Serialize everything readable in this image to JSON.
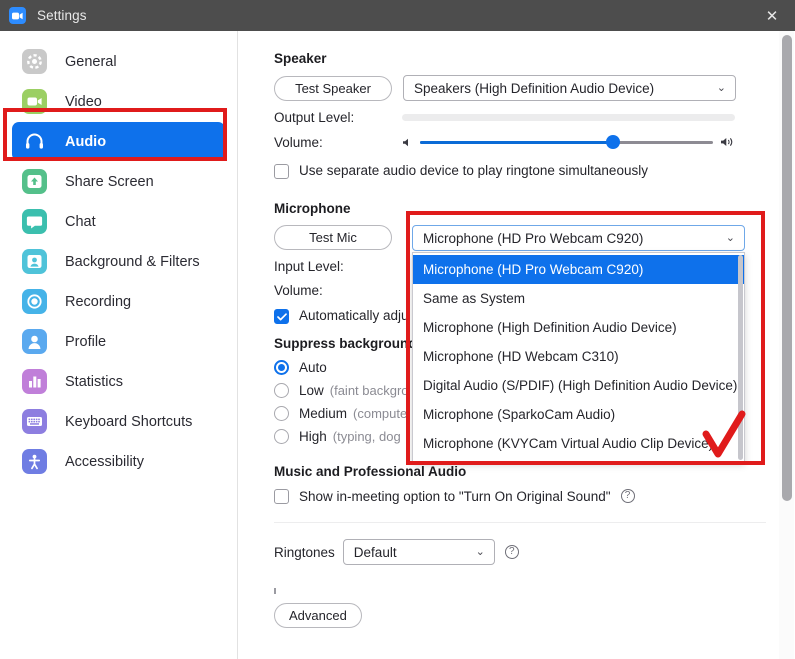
{
  "window": {
    "title": "Settings",
    "logo_icon": "zoom-video-icon",
    "close_icon": "close-icon",
    "titlebar_color": "#4d4d4d"
  },
  "accent_color": "#0e71eb",
  "annotation_color": "#e01b1b",
  "sidebar": {
    "items": [
      {
        "label": "General",
        "icon": "gear-icon",
        "icon_color": "#c6c6c6",
        "active": false
      },
      {
        "label": "Video",
        "icon": "video-camera-icon",
        "icon_color": "#9bcf63",
        "active": false
      },
      {
        "label": "Audio",
        "icon": "headphones-icon",
        "icon_color": "#0e71eb",
        "active": true
      },
      {
        "label": "Share Screen",
        "icon": "share-screen-icon",
        "icon_color": "#54c08a",
        "active": false
      },
      {
        "label": "Chat",
        "icon": "chat-bubble-icon",
        "icon_color": "#3bbfae",
        "active": false
      },
      {
        "label": "Background & Filters",
        "icon": "person-frame-icon",
        "icon_color": "#4fc3d9",
        "active": false
      },
      {
        "label": "Recording",
        "icon": "record-circle-icon",
        "icon_color": "#45b3e8",
        "active": false
      },
      {
        "label": "Profile",
        "icon": "person-icon",
        "icon_color": "#5aa9ef",
        "active": false
      },
      {
        "label": "Statistics",
        "icon": "bar-chart-icon",
        "icon_color": "#c07fd9",
        "active": false
      },
      {
        "label": "Keyboard Shortcuts",
        "icon": "keyboard-icon",
        "icon_color": "#8d7ee0",
        "active": false
      },
      {
        "label": "Accessibility",
        "icon": "accessibility-icon",
        "icon_color": "#6f7de3",
        "active": false
      }
    ]
  },
  "speaker": {
    "heading": "Speaker",
    "test_button": "Test Speaker",
    "device": "Speakers (High Definition Audio Device)",
    "output_level_label": "Output Level:",
    "output_level_percent": 0,
    "volume_label": "Volume:",
    "volume_percent": 66,
    "min_icon": "speaker-low-icon",
    "max_icon": "speaker-high-icon",
    "ringtone_checkbox": {
      "label": "Use separate audio device to play ringtone simultaneously",
      "checked": false
    }
  },
  "microphone": {
    "heading": "Microphone",
    "test_button": "Test Mic",
    "selected_device": "Microphone (HD Pro Webcam C920)",
    "input_level_label": "Input Level:",
    "volume_label": "Volume:",
    "auto_adjust": {
      "label": "Automatically adju",
      "checked": true
    },
    "dropdown_open": true,
    "dropdown_options": [
      "Microphone (HD Pro Webcam C920)",
      "Same as System",
      "Microphone (High Definition Audio Device)",
      "Microphone (HD Webcam C310)",
      "Digital Audio (S/PDIF) (High Definition Audio Device)",
      "Microphone (SparkoCam Audio)",
      "Microphone (KVYCam Virtual Audio Clip Device)"
    ],
    "dropdown_selected_index": 0
  },
  "suppress_noise": {
    "heading": "Suppress background",
    "options": [
      {
        "label": "Auto",
        "hint": "",
        "selected": true
      },
      {
        "label": "Low",
        "hint": "(faint backgro",
        "selected": false
      },
      {
        "label": "Medium",
        "hint": "(compute",
        "selected": false
      },
      {
        "label": "High",
        "hint": "(typing, dog",
        "selected": false
      }
    ]
  },
  "music_audio": {
    "heading": "Music and Professional Audio",
    "original_sound": {
      "label": "Show in-meeting option to \"Turn On Original Sound\"",
      "checked": false,
      "help_icon": "help-circle-icon"
    }
  },
  "ringtones": {
    "label": "Ringtones",
    "value": "Default",
    "help_icon": "help-circle-icon"
  },
  "footer": {
    "advanced_button": "Advanced"
  },
  "annotations": [
    {
      "name": "audio-tab-highlight",
      "shape": "rectangle"
    },
    {
      "name": "microphone-dropdown-highlight",
      "shape": "rectangle"
    },
    {
      "name": "dropdown-checkmark",
      "shape": "checkmark"
    }
  ]
}
